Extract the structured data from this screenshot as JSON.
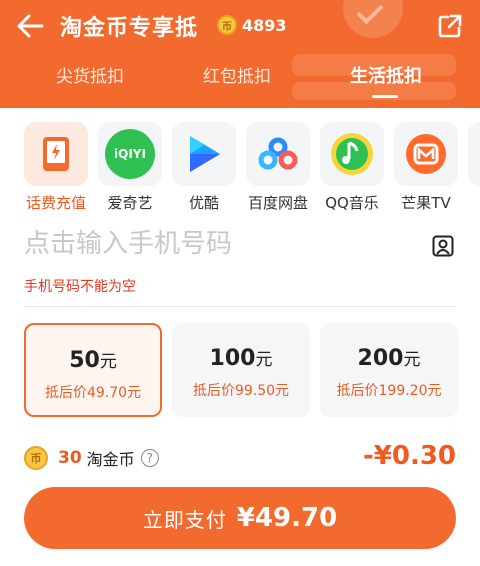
{
  "header": {
    "title": "淘金币专享抵",
    "coin_icon_text": "币",
    "coin_count": "4893",
    "tabs": [
      {
        "label": "尖货抵扣",
        "active": false
      },
      {
        "label": "红包抵扣",
        "active": false
      },
      {
        "label": "生活抵扣",
        "active": true
      }
    ]
  },
  "services": [
    {
      "label": "话费充值",
      "icon": "phone-charge-icon",
      "active": true
    },
    {
      "label": "爱奇艺",
      "icon": "iqiyi-icon",
      "icon_text": "iQIYI"
    },
    {
      "label": "优酷",
      "icon": "youku-icon"
    },
    {
      "label": "百度网盘",
      "icon": "baidu-netdisk-icon"
    },
    {
      "label": "QQ音乐",
      "icon": "qq-music-icon"
    },
    {
      "label": "芒果TV",
      "icon": "mango-tv-icon"
    },
    {
      "label": "腾",
      "icon": "tencent-icon"
    }
  ],
  "phone": {
    "placeholder": "点击输入手机号码",
    "error": "手机号码不能为空"
  },
  "options": [
    {
      "amount": "50",
      "unit": "元",
      "after": "抵后价49.70元",
      "selected": true
    },
    {
      "amount": "100",
      "unit": "元",
      "after": "抵后价99.50元",
      "selected": false
    },
    {
      "amount": "200",
      "unit": "元",
      "after": "抵后价199.20元",
      "selected": false
    }
  ],
  "deduction": {
    "coin_icon_text": "币",
    "coins": "30",
    "label": "淘金币",
    "help": "?",
    "amount": "-¥0.30"
  },
  "pay": {
    "label": "立即支付",
    "amount": "¥49.70"
  },
  "colors": {
    "brand": "#f26a2e",
    "accent_text": "#f05a1e",
    "error": "#e3371e",
    "coin": "#f6c744"
  }
}
